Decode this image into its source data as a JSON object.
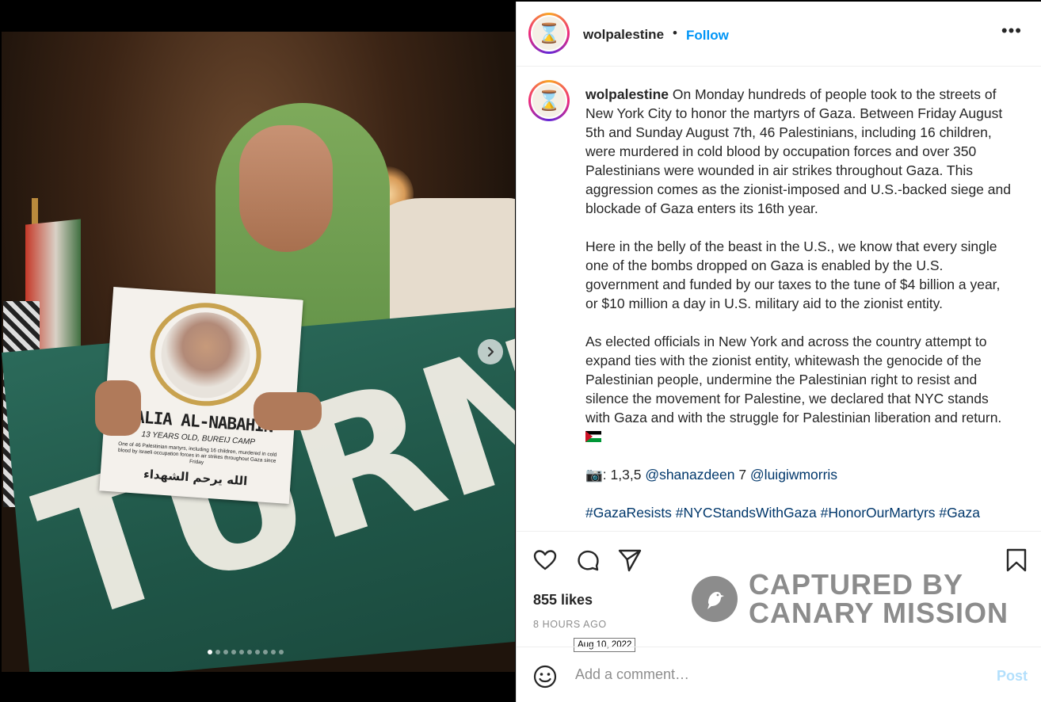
{
  "media": {
    "poster": {
      "name": "DALIA AL-NABAHIN",
      "age": "13 YEARS OLD, BUREIJ CAMP",
      "description": "One of 46 Palestinian martyrs, including 16 children, murdered in cold blood by israeli occupation forces in air strikes throughout Gaza since Friday",
      "arabic": "الله يرحم الشهداء"
    },
    "banner_text": "TURN",
    "carousel": {
      "count": 10,
      "active_index": 0
    }
  },
  "header": {
    "username": "wolpalestine",
    "separator": "•",
    "follow_label": "Follow",
    "more_icon": "more-options-icon",
    "more_glyph": "•••"
  },
  "caption": {
    "username": "wolpalestine",
    "paragraph1": "On Monday hundreds of people took to the streets of New York City to honor the martyrs of Gaza. Between Friday August 5th and Sunday August 7th, 46 Palestinians, including 16 children, were murdered in cold blood by occupation forces and over 350 Palestinians were wounded in air strikes throughout Gaza. This aggression comes as the zionist-imposed and U.S.-backed siege and blockade of Gaza enters its 16th year.",
    "paragraph2": "Here in the belly of the beast in the U.S., we know that every single one of the bombs dropped on Gaza is enabled by the U.S. government and funded by our taxes to the tune of $4 billion a year, or $10 million a day in U.S. military aid to the zionist entity.",
    "paragraph3": "As elected officials in New York and across the country attempt to expand ties with the zionist entity, whitewash the genocide of the Palestinian people, undermine the Palestinian right to resist and silence the movement for Palestine, we declared that NYC stands with Gaza and with the struggle for Palestinian liberation and return.",
    "credits_prefix": ": 1,3,5 ",
    "credit1": "@shanazdeen",
    "credits_mid": " 7 ",
    "credit2": "@luigiwmorris",
    "hashtags": "#GazaResists #NYCStandsWithGaza #HonorOurMartyrs #Gaza"
  },
  "actions": {
    "likes": "855 likes",
    "time": "8 HOURS AGO",
    "tooltip": "Aug 10, 2022"
  },
  "comment": {
    "placeholder": "Add a comment…",
    "post_label": "Post"
  },
  "watermark": {
    "line1": "CAPTURED BY",
    "line2": "CANARY MISSION"
  },
  "colors": {
    "link": "#0095f6",
    "hashtag": "#00376b",
    "post_disabled": "#b2dffc",
    "watermark": "#8c8c8c"
  }
}
